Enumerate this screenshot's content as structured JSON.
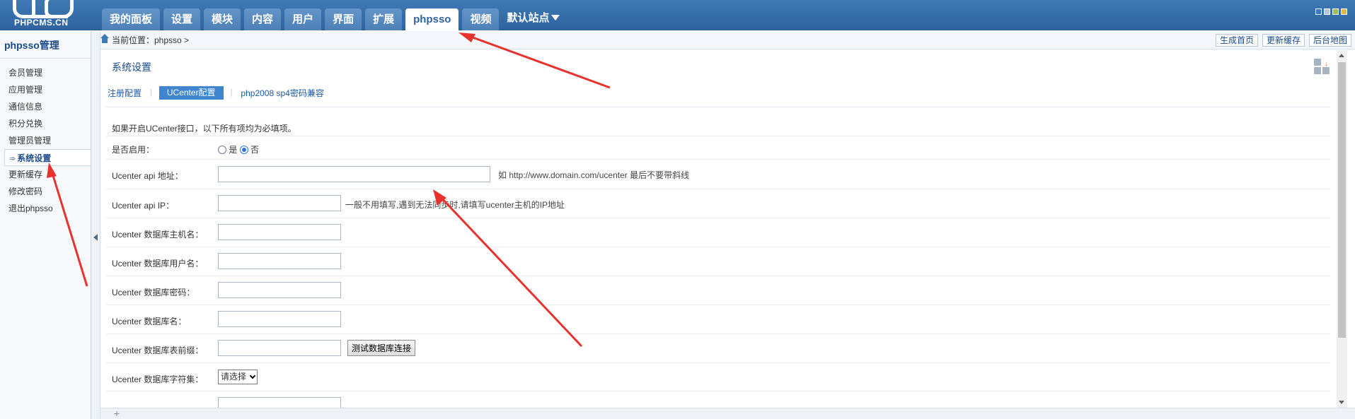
{
  "logo": {
    "text": "PHPCMS.CN"
  },
  "nav": {
    "tabs": [
      {
        "label": "我的面板",
        "active": false
      },
      {
        "label": "设置",
        "active": false
      },
      {
        "label": "模块",
        "active": false
      },
      {
        "label": "内容",
        "active": false
      },
      {
        "label": "用户",
        "active": false
      },
      {
        "label": "界面",
        "active": false
      },
      {
        "label": "扩展",
        "active": false
      },
      {
        "label": "phpsso",
        "active": true
      },
      {
        "label": "视频",
        "active": false
      }
    ],
    "site_select": "默认站点",
    "style_colors": [
      "#3f79b4",
      "#b7c6d6",
      "#9ac25a",
      "#d9b94a"
    ]
  },
  "sidebar": {
    "title": "phpsso管理",
    "items": [
      {
        "label": "会员管理"
      },
      {
        "label": "应用管理"
      },
      {
        "label": "通信信息"
      },
      {
        "label": "积分兑换"
      },
      {
        "label": "管理员管理"
      },
      {
        "label": "系统设置",
        "active": true
      },
      {
        "label": "更新缓存"
      },
      {
        "label": "修改密码"
      },
      {
        "label": "退出phpsso"
      }
    ]
  },
  "crumb": {
    "text": "当前位置：phpsso >"
  },
  "quick": [
    "生成首页",
    "更新缓存",
    "后台地图"
  ],
  "panel": {
    "title": "系统设置",
    "subtabs": [
      "注册配置",
      "UCenter配置",
      "php2008 sp4密码兼容"
    ],
    "active_subtab": 1
  },
  "form": {
    "notice": "如果开启UCenter接口，以下所有项均为必填项。",
    "enable": {
      "label": "是否启用：",
      "yes": "是",
      "no": "否",
      "selected": "no"
    },
    "api_url": {
      "label": "Ucenter api 地址：",
      "value": "",
      "hint": "如 http://www.domain.com/ucenter 最后不要带斜线"
    },
    "api_ip": {
      "label": "Ucenter api IP：",
      "value": "",
      "hint": "一般不用填写,遇到无法同步时,请填写ucenter主机的IP地址"
    },
    "db_host": {
      "label": "Ucenter 数据库主机名：",
      "value": ""
    },
    "db_user": {
      "label": "Ucenter 数据库用户名：",
      "value": ""
    },
    "db_pass": {
      "label": "Ucenter 数据库密码：",
      "value": ""
    },
    "db_name": {
      "label": "Ucenter 数据库名：",
      "value": ""
    },
    "db_prefix": {
      "label": "Ucenter 数据库表前缀：",
      "value": "",
      "button": "测试数据库连接"
    },
    "db_charset": {
      "label": "Ucenter 数据库字符集：",
      "selected": "请选择"
    }
  },
  "annotation_color": "#e8322d"
}
